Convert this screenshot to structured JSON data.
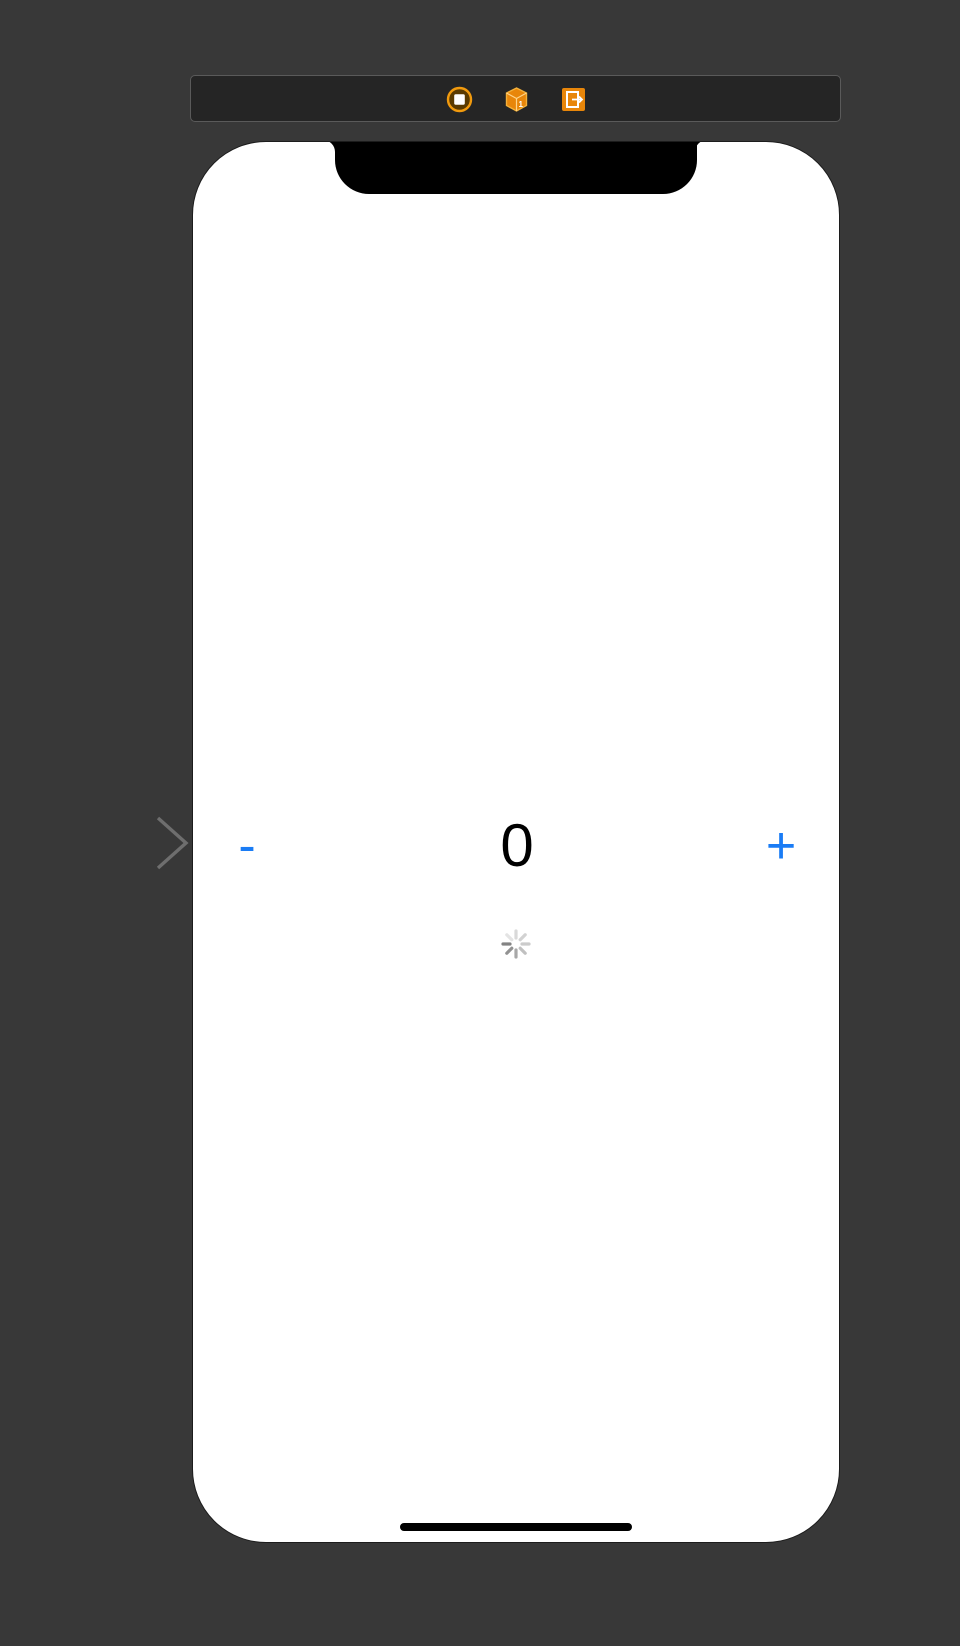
{
  "scene_dock": {
    "icons": [
      "view-controller-icon",
      "first-responder-icon",
      "exit-icon"
    ],
    "accent_color": "#f19a0e"
  },
  "entry_point": {
    "icon": "entry-arrow-icon",
    "color": "#6e6e6e"
  },
  "device": {
    "counter": {
      "decrement_label": "-",
      "value": "0",
      "increment_label": "+"
    },
    "activity_indicator": "spinner-icon",
    "tint_color": "#1a7cf5"
  }
}
